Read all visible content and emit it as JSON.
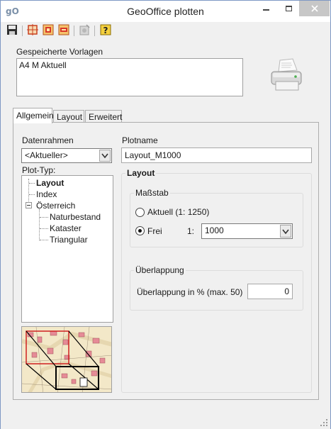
{
  "window": {
    "app_icon_text": "gO",
    "title": "GeoOffice plotten"
  },
  "toolbar": {
    "buttons": [
      {
        "name": "save-icon",
        "color": "#2a2a2a"
      },
      {
        "name": "frame-icon",
        "color": "#d24b2b"
      },
      {
        "name": "template-add-icon",
        "color": "#d24b2b"
      },
      {
        "name": "template-remove-icon",
        "color": "#d24b2b"
      },
      {
        "name": "settings-icon",
        "color": "#9a9a9a"
      },
      {
        "name": "help-icon",
        "color": "#e7b400"
      }
    ]
  },
  "templates": {
    "label": "Gespeicherte Vorlagen",
    "items": [
      "A4 M Aktuell"
    ]
  },
  "tabs": [
    {
      "label": "Allgemein",
      "active": true
    },
    {
      "label": "Layout",
      "active": false
    },
    {
      "label": "Erweitert",
      "active": false
    }
  ],
  "general": {
    "datenrahmen_label": "Datenrahmen",
    "datenrahmen_value": "<Aktueller>",
    "plottyp_label": "Plot-Typ:",
    "plotname_label": "Plotname",
    "plotname_value": "Layout_M1000",
    "tree": [
      {
        "label": "Layout",
        "bold": true
      },
      {
        "label": "Index",
        "bold": false
      },
      {
        "label": "Österreich",
        "bold": false
      },
      {
        "label": "Naturbestand",
        "bold": false
      },
      {
        "label": "Kataster",
        "bold": false
      },
      {
        "label": "Triangular",
        "bold": false
      }
    ]
  },
  "layout_group": {
    "title": "Layout",
    "scale_group_title": "Maßstab",
    "option_current": "Aktuell (1: 1250)",
    "option_free": "Frei",
    "ratio_label": "1:",
    "scale_value": "1000",
    "selected": "Frei",
    "overlap_group_title": "Überlappung",
    "overlap_label": "Überlappung in % (max. 50)",
    "overlap_value": "0"
  }
}
